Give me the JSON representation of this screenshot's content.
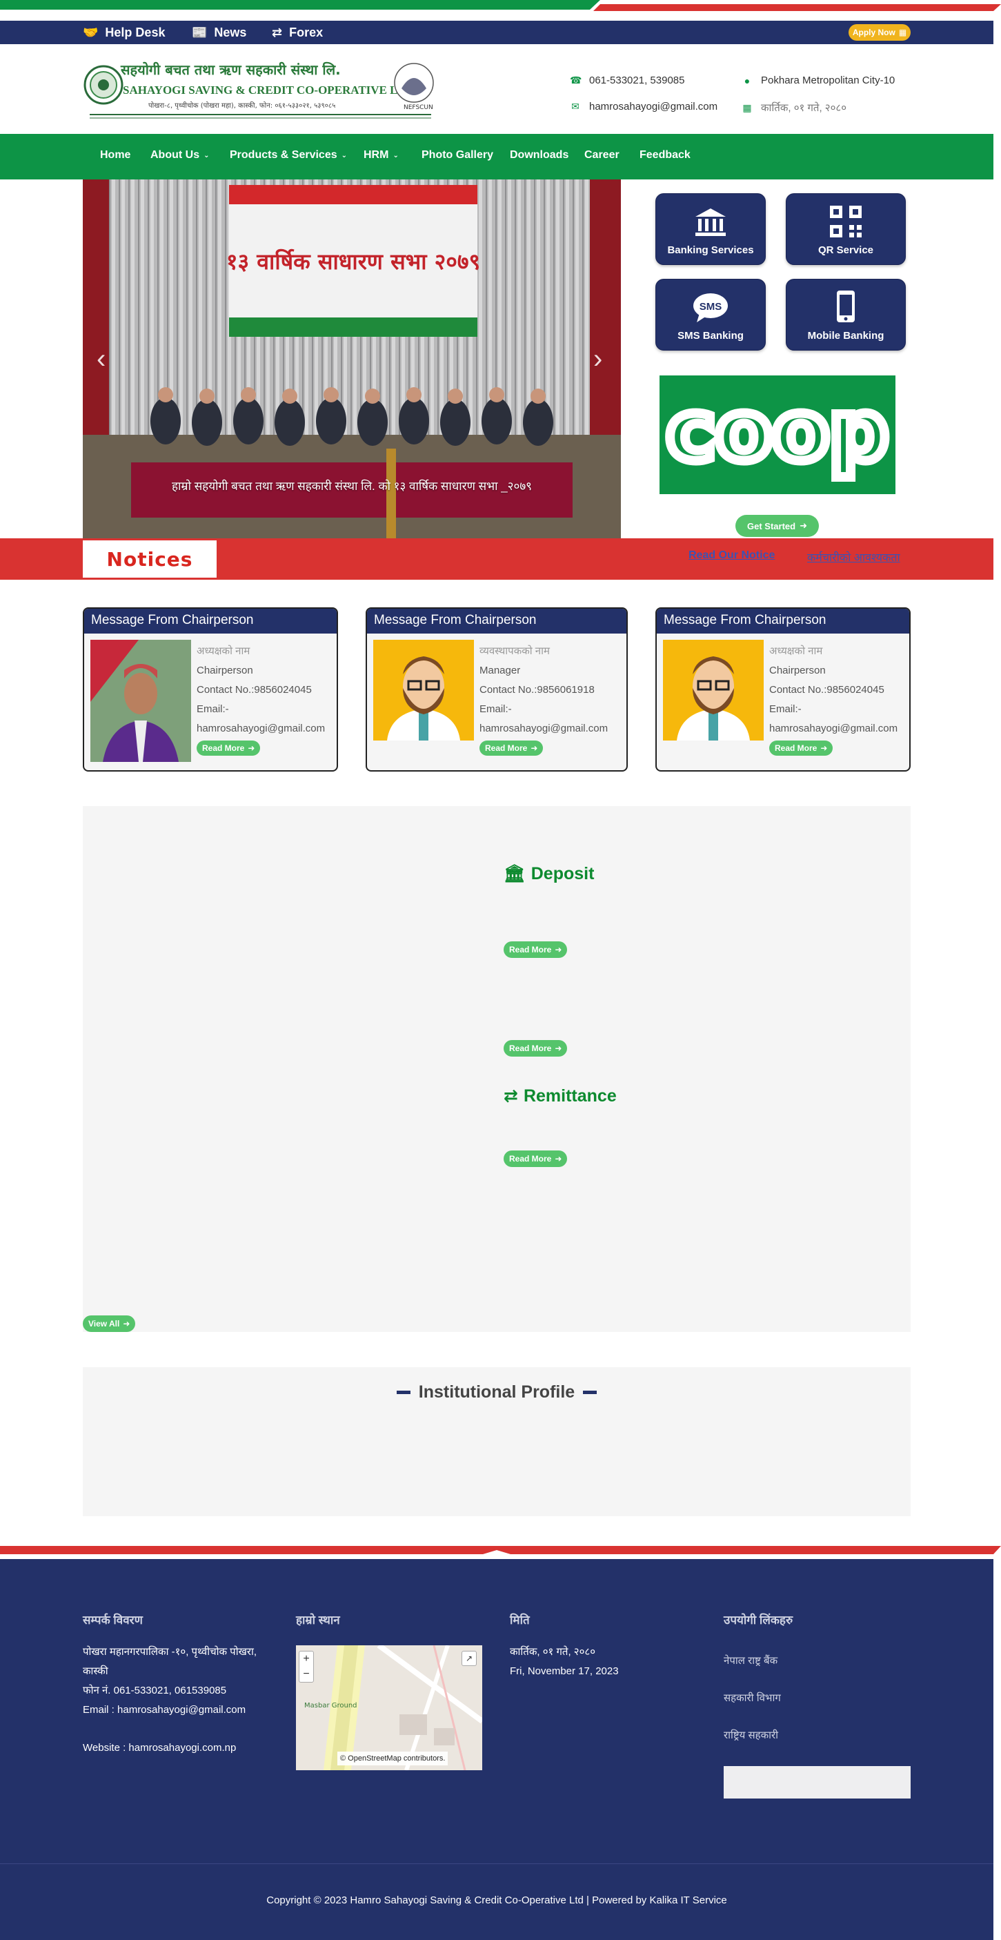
{
  "topbar": {
    "help_desk": "Help Desk",
    "news": "News",
    "forex": "Forex",
    "apply_now": "Apply Now"
  },
  "header": {
    "logo_lines": [
      "सहयोगी बचत तथा ऋण सहकारी संस्था लि.",
      "SAHAYOGI SAVING & CREDIT CO-OPERATIVE LTD.",
      "पोखरा-८, पृथ्वीचोक (पोखरा महा), कास्की, फोन: ०६१-५३३०२१, ५३९०८५"
    ],
    "phone": "061-533021, 539085",
    "email": "hamrosahayogi@gmail.com",
    "address": "Pokhara Metropolitan City-10",
    "date_np": "कार्तिक, ०१ गते, २०८०"
  },
  "nav": {
    "items": [
      {
        "label": "Home",
        "dropdown": false
      },
      {
        "label": "About Us",
        "dropdown": true
      },
      {
        "label": "Products & Services",
        "dropdown": true
      },
      {
        "label": "HRM",
        "dropdown": true
      },
      {
        "label": "Photo Gallery",
        "dropdown": false
      },
      {
        "label": "Downloads",
        "dropdown": false
      },
      {
        "label": "Career",
        "dropdown": false
      },
      {
        "label": "Feedback",
        "dropdown": false
      }
    ]
  },
  "slider": {
    "caption": "हाम्रो सहयोगी बचत तथा ऋण सहकारी संस्था लि. को १३ वार्षिक साधारण सभा _२०७९",
    "banner_title": "१३ वार्षिक साधारण सभा २०७९"
  },
  "services": {
    "tiles": [
      {
        "label": "Banking Services",
        "icon": "bank-icon"
      },
      {
        "label": "QR Service",
        "icon": "qr-code-icon"
      },
      {
        "label": "SMS Banking",
        "icon": "sms-icon"
      },
      {
        "label": "Mobile Banking",
        "icon": "mobile-icon"
      }
    ],
    "coop_logo_text": "coop",
    "get_started": "Get Started"
  },
  "notices": {
    "label": "Notices",
    "items": [
      "Read Our Notice",
      "कर्मचारीको आवश्यकता"
    ]
  },
  "messages": [
    {
      "title": "Message From Chairperson",
      "name": "अध्यक्षको नाम",
      "role": "Chairperson",
      "contact": "Contact No.:9856024045",
      "email_label": "Email:-",
      "email": "hamrosahayogi@gmail.com",
      "read_more": "Read More"
    },
    {
      "title": "Message From Chairperson",
      "name": "व्यवस्थापकको नाम",
      "role": "Manager",
      "contact": "Contact No.:9856061918",
      "email_label": "Email:-",
      "email": "hamrosahayogi@gmail.com",
      "read_more": "Read More"
    },
    {
      "title": "Message From Chairperson",
      "name": "अध्यक्षको नाम",
      "role": "Chairperson",
      "contact": "Contact No.:9856024045",
      "email_label": "Email:-",
      "email": "hamrosahayogi@gmail.com",
      "read_more": "Read More"
    }
  ],
  "products": {
    "deposit_title": "Deposit",
    "remittance_title": "Remittance",
    "read_more": "Read More",
    "view_all": "View All"
  },
  "profile": {
    "title": "Institutional Profile"
  },
  "footer": {
    "col1_head": "सम्पर्क विवरण",
    "col1_address": "पोखरा महानगरपालिका -१०, पृथ्वीचोक पोखरा, कास्की",
    "col1_phone": "फोन नं. 061-533021, 061539085",
    "col1_email": "Email : hamrosahayogi@gmail.com",
    "col1_website": "Website : hamrosahayogi.com.np",
    "col2_head": "हाम्रो स्थान",
    "map_attribution": "© OpenStreetMap contributors.",
    "map_label": "Masbar Ground",
    "col3_head": "मिति",
    "col3_date_np": "कार्तिक, ०१ गते, २०८०",
    "col3_date_en": "Fri, November 17, 2023",
    "col4_head": "उपयोगी लिंकहरु",
    "col4_links": [
      "नेपाल राष्ट्र बैंक",
      "सहकारी विभाग",
      "राष्ट्रिय सहकारी"
    ],
    "copyright": "Copyright © 2023 Hamro Sahayogi Saving & Credit Co-Operative Ltd | Powered by Kalika IT Service"
  },
  "colors": {
    "navy": "#233169",
    "green": "#0d9446",
    "red": "#d93331",
    "light_green": "#55c46b",
    "amber": "#f0b41e"
  }
}
